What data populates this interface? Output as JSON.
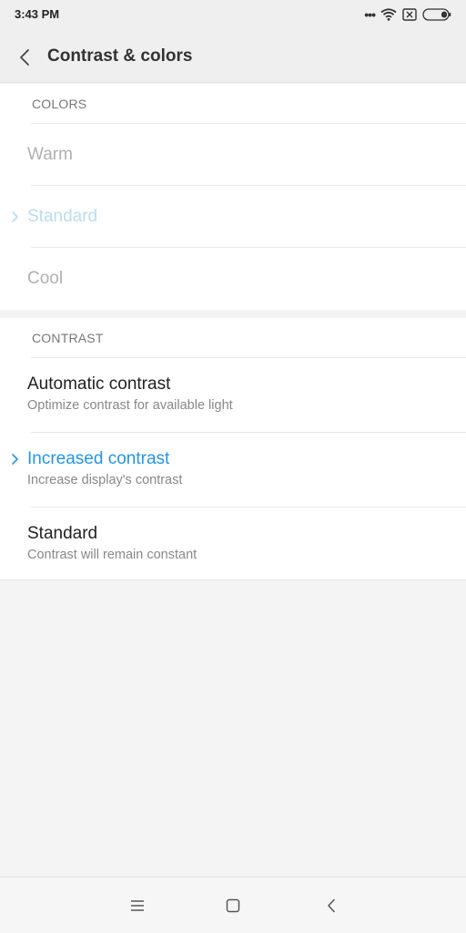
{
  "status_bar": {
    "time": "3:43 PM",
    "icons": [
      "more-dots-icon",
      "wifi-icon",
      "sim-off-icon",
      "battery-icon"
    ]
  },
  "header": {
    "title": "Contrast & colors",
    "back_icon": "chevron-left-icon"
  },
  "colors_section": {
    "title": "COLORS",
    "options": [
      {
        "label": "Warm",
        "selected": false,
        "enabled": false
      },
      {
        "label": "Standard",
        "selected": true,
        "enabled": false
      },
      {
        "label": "Cool",
        "selected": false,
        "enabled": false
      }
    ]
  },
  "contrast_section": {
    "title": "CONTRAST",
    "options": [
      {
        "label": "Automatic contrast",
        "subtitle": "Optimize contrast for available light",
        "selected": false
      },
      {
        "label": "Increased contrast",
        "subtitle": "Increase display's contrast",
        "selected": true
      },
      {
        "label": "Standard",
        "subtitle": "Contrast will remain constant",
        "selected": false
      }
    ]
  },
  "nav_bar": {
    "icons": [
      "menu-icon",
      "home-icon",
      "back-icon"
    ]
  },
  "colors": {
    "accent": "#2196e6",
    "accent_disabled": "#b9dcf3",
    "background": "#f4f4f4"
  }
}
